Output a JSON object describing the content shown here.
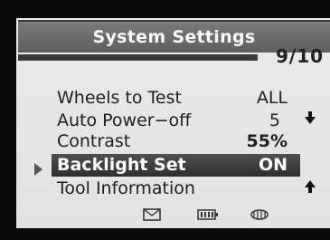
{
  "header": {
    "title": "System Settings",
    "page": "9/10"
  },
  "menu": [
    {
      "label": "Wheels to Test",
      "value": "ALL"
    },
    {
      "label": "Auto Power−off",
      "value": "5"
    },
    {
      "label": "Contrast",
      "value": "55%"
    },
    {
      "label": "Backlight Set",
      "value": "ON",
      "selected": true
    },
    {
      "label": "Tool Information",
      "value": ""
    }
  ],
  "icons": [
    "message-icon",
    "battery-icon",
    "tire-icon",
    "scroll-down-icon",
    "scroll-up-icon",
    "selection-arrow-icon"
  ]
}
